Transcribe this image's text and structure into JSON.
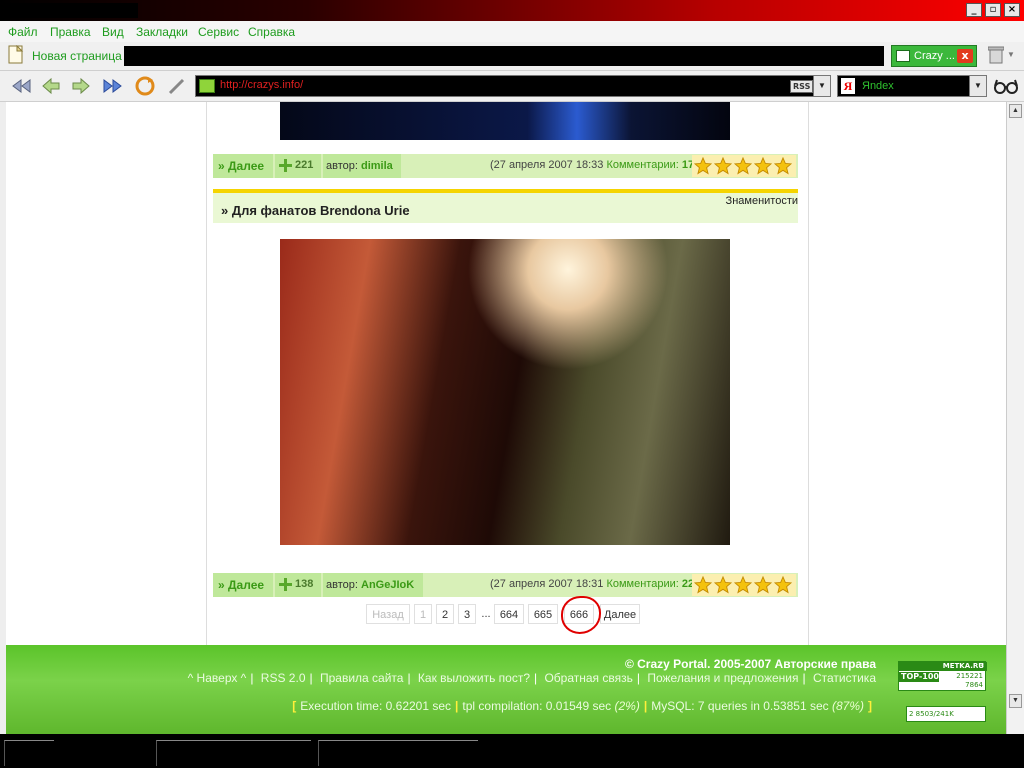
{
  "window": {
    "min_label": "_",
    "max_label": "▫",
    "close_label": "×"
  },
  "menu": [
    "Файл",
    "Правка",
    "Вид",
    "Закладки",
    "Сервис",
    "Справка"
  ],
  "tabs": {
    "new_page_label": "Новая страница",
    "active_tab_label": "Crazy ...",
    "close_label": "x"
  },
  "address": {
    "url": "http://crazys.info/",
    "rss_label": "RSS",
    "search_engine": "Яndex"
  },
  "posts": [
    {
      "more_label": "» Далее",
      "plus_count": "221",
      "author_label": "автор:",
      "author": "dimila",
      "date": "(27 апреля 2007 18:33",
      "comments_label": "Комментарии:",
      "comments_count": "17)",
      "rating": 5
    },
    {
      "title": "» Для фанатов Brendona Urie",
      "category": "Знаменитости",
      "more_label": "» Далее",
      "plus_count": "138",
      "author_label": "автор:",
      "author": "AnGeJIoK",
      "date": "(27 апреля 2007 18:31",
      "comments_label": "Комментарии:",
      "comments_count": "22)",
      "rating": 5
    }
  ],
  "pager": {
    "back_label": "Назад",
    "pages": [
      "1",
      "2",
      "3",
      "...",
      "664",
      "665",
      "666"
    ],
    "current": "666",
    "next_label": "Далее"
  },
  "footer": {
    "copyright": "© Crazy Portal. 2005-2007 Авторские права",
    "links": [
      "^ Наверх ^",
      "RSS 2.0",
      "Правила сайта",
      "Как выложить пост?",
      "Обратная связь",
      "Пожелания и предложения",
      "Статистика"
    ],
    "stats": {
      "bracket_open": "[",
      "exec": "Execution time: 0.62201 sec",
      "tpl": "tpl compilation: 0.01549 sec",
      "tpl_pct": "(2%)",
      "mysql": "MySQL: 7 queries in 0.53851 sec",
      "mysql_pct": "(87%)",
      "bracket_close": "]"
    },
    "counter1": {
      "brand": "METKA.RU",
      "num1": "3",
      "top_label": "TOP-100",
      "num2": "215221",
      "num3": "7864"
    },
    "counter2": {
      "text": "2 8503/241K"
    }
  },
  "colors": {
    "accent_green": "#3b9a16",
    "footer_green": "#5bc42a",
    "title_red": "#e00000",
    "highlight_yellow": "#f5d400"
  }
}
